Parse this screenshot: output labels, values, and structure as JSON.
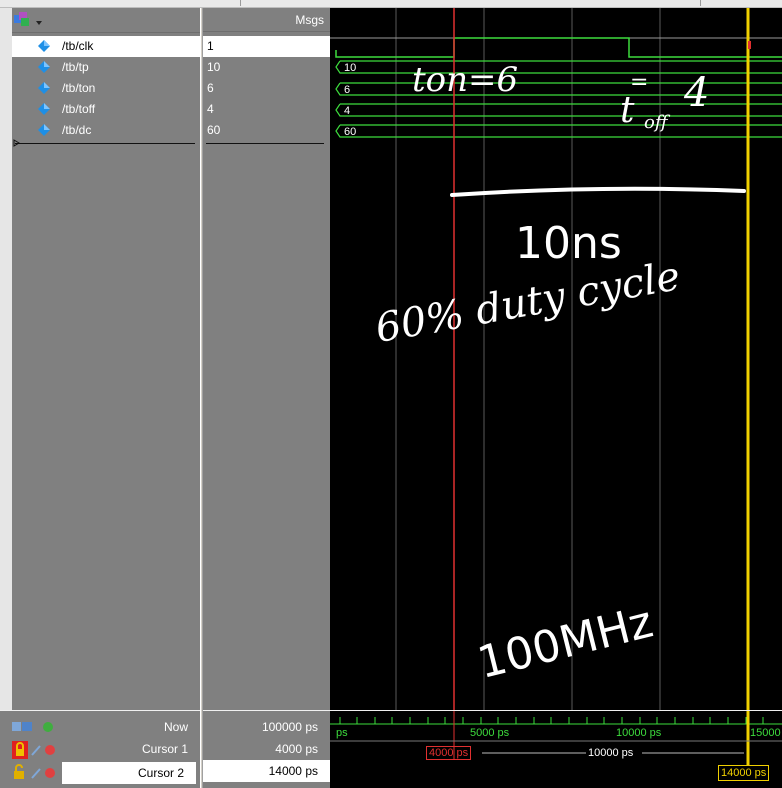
{
  "signals": [
    {
      "name": "/tb/clk",
      "value": "1",
      "selected": true
    },
    {
      "name": "/tb/tp",
      "value": "10"
    },
    {
      "name": "/tb/ton",
      "value": "6"
    },
    {
      "name": "/tb/toff",
      "value": "4"
    },
    {
      "name": "/tb/dc",
      "value": "60"
    }
  ],
  "headers": {
    "msgs": "Msgs"
  },
  "bottom": {
    "now_label": "Now",
    "now_value": "100000 ps",
    "cursor1_label": "Cursor 1",
    "cursor1_value": "4000 ps",
    "cursor2_label": "Cursor 2",
    "cursor2_value": "14000 ps"
  },
  "timeline": {
    "tick_labels": [
      "ps",
      "5000 ps",
      "10000 ps",
      "15000"
    ],
    "cursor1_tag": "4000 ps",
    "delta_label": "10000 ps",
    "cursor2_tag": "14000 ps"
  },
  "bus_values": [
    "10",
    "6",
    "4",
    "60"
  ],
  "annotations": {
    "ton": "ton=6",
    "toff_t": "t",
    "toff_sub": "off",
    "toff_eq": "=",
    "toff_val": "4",
    "period": "10ns",
    "duty": "60% duty cycle",
    "freq": "100MHz"
  },
  "colors": {
    "wave_green": "#3ddc3d",
    "cursor1": "#e03030",
    "cursor2": "#f0d000",
    "icon_blue": "#1e8fe6"
  }
}
